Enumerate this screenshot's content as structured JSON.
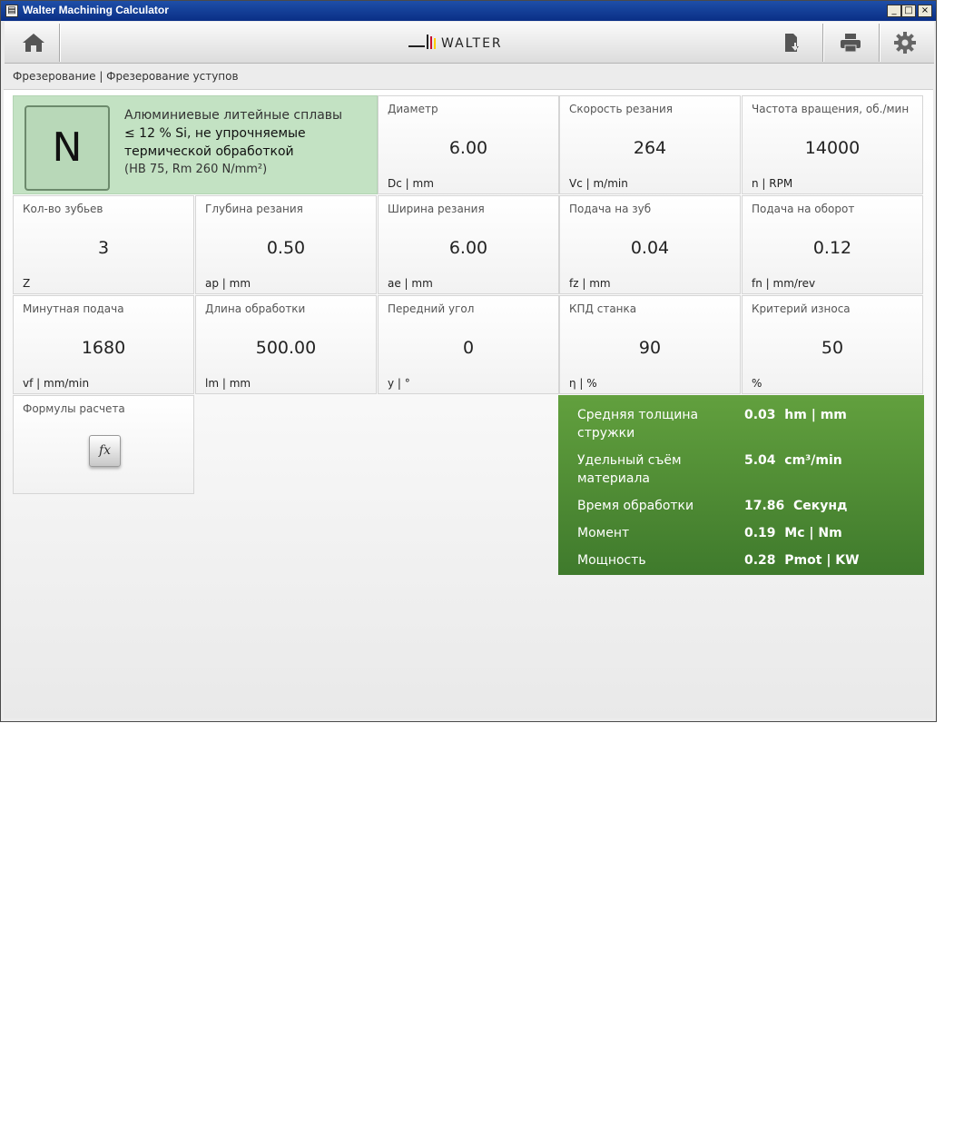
{
  "window": {
    "title": "Walter Machining Calculator",
    "minimize": "_",
    "maximize": "□",
    "close": "×"
  },
  "logo": {
    "text": "WALTER"
  },
  "toolbar": {
    "icons": [
      "home-icon",
      "export-icon",
      "print-icon",
      "gear-icon"
    ]
  },
  "breadcrumb": "Фрезерование | Фрезерование уступов",
  "material": {
    "letter": "N",
    "line1": "Алюминиевые литейные сплавы",
    "line2": "≤ 12 % Si, не упрочняемые",
    "line3": "термической обработкой",
    "line4": "(HB 75, Rm 260 N/mm²)",
    "color": "#c3e2c3"
  },
  "params": [
    {
      "label": "Диаметр",
      "value": "6.00",
      "unit": "Dc | mm"
    },
    {
      "label": "Скорость резания",
      "value": "264",
      "unit": "Vc | m/min"
    },
    {
      "label": "Частота вращения, об./мин",
      "value": "14000",
      "unit": "n | RPM"
    },
    {
      "label": "Кол-во зубьев",
      "value": "3",
      "unit": "Z"
    },
    {
      "label": "Глубина резания",
      "value": "0.50",
      "unit": "ap | mm"
    },
    {
      "label": "Ширина резания",
      "value": "6.00",
      "unit": "ae | mm"
    },
    {
      "label": "Подача на зуб",
      "value": "0.04",
      "unit": "fz | mm"
    },
    {
      "label": "Подача на оборот",
      "value": "0.12",
      "unit": "fn | mm/rev"
    },
    {
      "label": "Минутная подача",
      "value": "1680",
      "unit": "vf | mm/min"
    },
    {
      "label": "Длина обработки",
      "value": "500.00",
      "unit": "lm | mm"
    },
    {
      "label": "Передний угол",
      "value": "0",
      "unit": "y | °"
    },
    {
      "label": "КПД станка",
      "value": "90",
      "unit": "η | %"
    },
    {
      "label": "Критерий износа",
      "value": "50",
      "unit": "%"
    }
  ],
  "formulas": {
    "label": "Формулы расчета",
    "button": "fx"
  },
  "results": [
    {
      "label": "Средняя толщина стружки",
      "value": "0.03  hm | mm"
    },
    {
      "label": "Удельный съём материала",
      "value": "5.04  cm³/min"
    },
    {
      "label": "Время обработки",
      "value": "17.86  Секунд"
    },
    {
      "label": "Момент",
      "value": "0.19  Mc | Nm"
    },
    {
      "label": "Мощность",
      "value": "0.28  Pmot | KW"
    }
  ],
  "colors": {
    "results_green": "#4f8d35",
    "title_blue": "#0a2f86"
  }
}
